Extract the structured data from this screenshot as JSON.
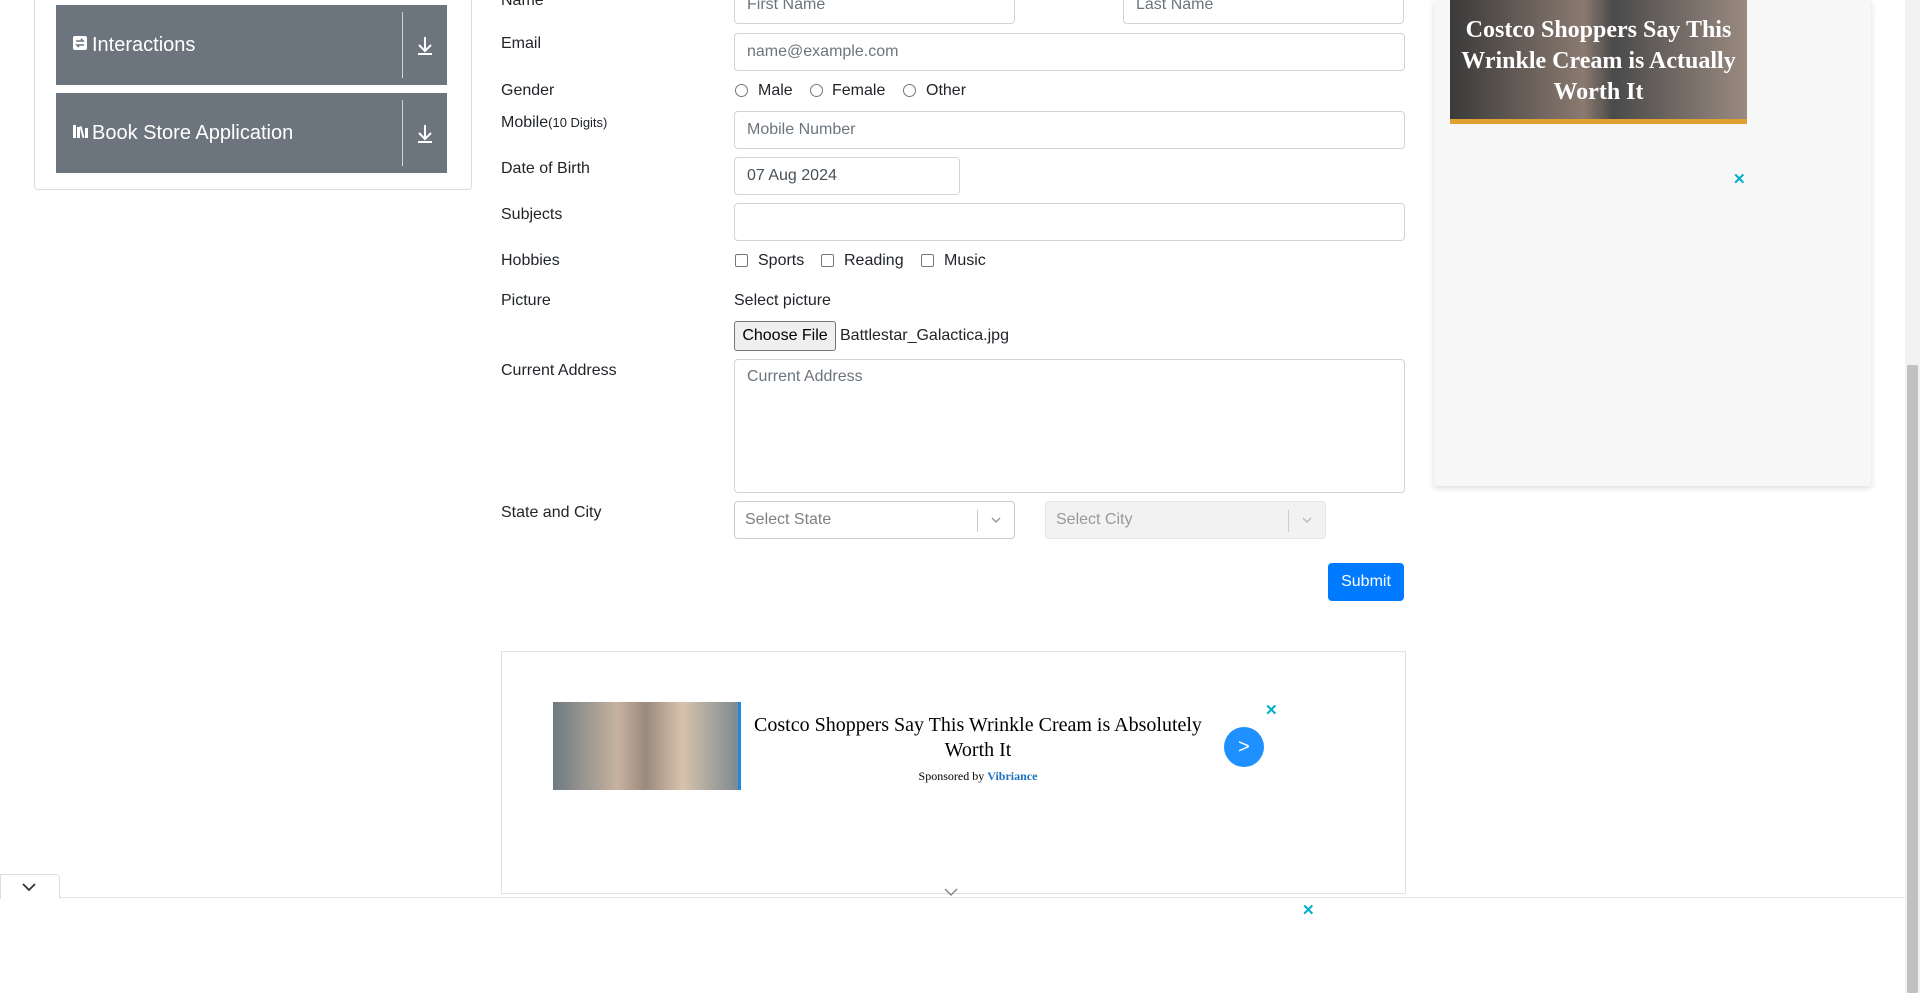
{
  "sidebar": {
    "groups": [
      {
        "label": "Interactions",
        "icon": "interactions-icon"
      },
      {
        "label": "Book Store Application",
        "icon": "book-icon"
      }
    ]
  },
  "form": {
    "name": {
      "label": "Name",
      "first_placeholder": "First Name",
      "last_placeholder": "Last Name"
    },
    "email": {
      "label": "Email",
      "placeholder": "name@example.com"
    },
    "gender": {
      "label": "Gender",
      "options": [
        "Male",
        "Female",
        "Other"
      ]
    },
    "mobile": {
      "label": "Mobile",
      "hint": "(10 Digits)",
      "placeholder": "Mobile Number"
    },
    "dob": {
      "label": "Date of Birth",
      "value": "07 Aug 2024"
    },
    "subjects": {
      "label": "Subjects"
    },
    "hobbies": {
      "label": "Hobbies",
      "options": [
        "Sports",
        "Reading",
        "Music"
      ]
    },
    "picture": {
      "label": "Picture",
      "select_label": "Select picture",
      "button": "Choose File",
      "file_name": "Battlestar_Galactica.jpg"
    },
    "address": {
      "label": "Current Address",
      "placeholder": "Current Address"
    },
    "state_city": {
      "label": "State and City",
      "state_placeholder": "Select State",
      "city_placeholder": "Select City"
    },
    "submit": "Submit"
  },
  "ads": {
    "right": {
      "headline": "Costco Shoppers Say This Wrinkle Cream is Actually Worth It",
      "close": "✕"
    },
    "bottom": {
      "title": "Costco Shoppers Say This Wrinkle Cream is Absolutely Worth It",
      "sponsored_by": "Sponsored by",
      "brand": "Vibriance",
      "go": ">",
      "close": "✕"
    },
    "footer_close": "✕"
  },
  "colors": {
    "primary": "#007bff",
    "sidebar_group": "#6c757d",
    "ad_close": "#00aecd"
  }
}
